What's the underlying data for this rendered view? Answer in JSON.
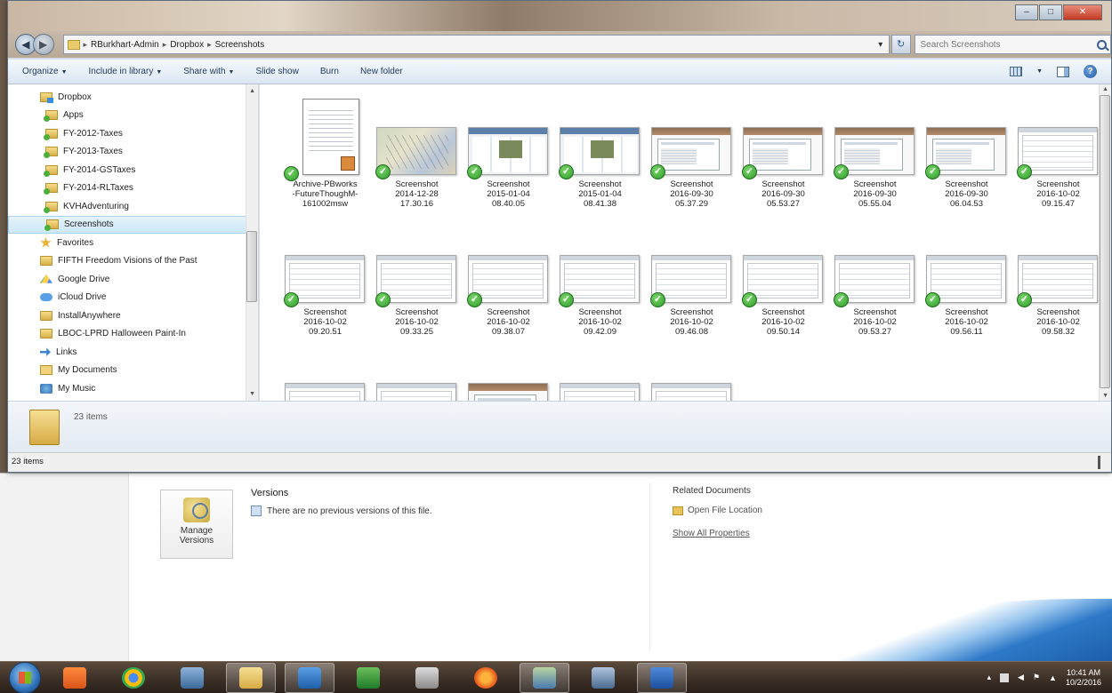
{
  "window": {
    "controls": {
      "minimize": "–",
      "maximize": "□",
      "close": "✕"
    }
  },
  "address": {
    "breadcrumbs": [
      "RBurkhart-Admin",
      "Dropbox",
      "Screenshots"
    ],
    "search_placeholder": "Search Screenshots"
  },
  "toolbar": {
    "items": [
      "Organize",
      "Include in library",
      "Share with",
      "Slide show",
      "Burn",
      "New folder"
    ]
  },
  "navpane": {
    "items": [
      {
        "label": "Dropbox",
        "icon": "dropbox-folder-icon"
      },
      {
        "label": "Apps",
        "icon": "folder-icon"
      },
      {
        "label": "FY-2012-Taxes",
        "icon": "folder-icon"
      },
      {
        "label": "FY-2013-Taxes",
        "icon": "folder-icon"
      },
      {
        "label": "FY-2014-GSTaxes",
        "icon": "folder-icon"
      },
      {
        "label": "FY-2014-RLTaxes",
        "icon": "folder-icon"
      },
      {
        "label": "KVHAdventuring",
        "icon": "folder-icon"
      },
      {
        "label": "Screenshots",
        "icon": "folder-icon"
      },
      {
        "label": "Favorites",
        "icon": "star-icon"
      },
      {
        "label": "FIFTH Freedom Visions of the Past",
        "icon": "folder-icon"
      },
      {
        "label": "Google Drive",
        "icon": "google-drive-icon"
      },
      {
        "label": "iCloud Drive",
        "icon": "icloud-icon"
      },
      {
        "label": "InstallAnywhere",
        "icon": "folder-icon"
      },
      {
        "label": "LBOC-LPRD Halloween Paint-In",
        "icon": "folder-icon"
      },
      {
        "label": "Links",
        "icon": "links-icon"
      },
      {
        "label": "My Documents",
        "icon": "documents-icon"
      },
      {
        "label": "My Music",
        "icon": "music-icon"
      }
    ]
  },
  "files": [
    {
      "name": "Archive-PBworks\n-FutureThoughM-\n161002msw",
      "kind": "doc"
    },
    {
      "name": "Screenshot\n2014-12-28\n17.30.16",
      "kind": "map"
    },
    {
      "name": "Screenshot\n2015-01-04\n08.40.05",
      "kind": "browser"
    },
    {
      "name": "Screenshot\n2015-01-04\n08.41.38",
      "kind": "browser"
    },
    {
      "name": "Screenshot\n2016-09-30\n05.37.29",
      "kind": "win"
    },
    {
      "name": "Screenshot\n2016-09-30\n05.53.27",
      "kind": "win"
    },
    {
      "name": "Screenshot\n2016-09-30\n05.55.04",
      "kind": "win"
    },
    {
      "name": "Screenshot\n2016-09-30\n06.04.53",
      "kind": "win"
    },
    {
      "name": "Screenshot\n2016-10-02\n09.15.47",
      "kind": "wht"
    },
    {
      "name": "Screenshot\n2016-10-02\n09.20.51",
      "kind": "wht"
    },
    {
      "name": "Screenshot\n2016-10-02\n09.33.25",
      "kind": "wht"
    },
    {
      "name": "Screenshot\n2016-10-02\n09.38.07",
      "kind": "wht"
    },
    {
      "name": "Screenshot\n2016-10-02\n09.42.09",
      "kind": "wht"
    },
    {
      "name": "Screenshot\n2016-10-02\n09.46.08",
      "kind": "wht"
    },
    {
      "name": "Screenshot\n2016-10-02\n09.50.14",
      "kind": "wht"
    },
    {
      "name": "Screenshot\n2016-10-02\n09.53.27",
      "kind": "wht"
    },
    {
      "name": "Screenshot\n2016-10-02\n09.56.11",
      "kind": "wht"
    },
    {
      "name": "Screenshot\n2016-10-02\n09.58.32",
      "kind": "wht"
    },
    {
      "name": "",
      "kind": "wht"
    },
    {
      "name": "",
      "kind": "wht"
    },
    {
      "name": "",
      "kind": "win"
    },
    {
      "name": "",
      "kind": "wht"
    },
    {
      "name": "",
      "kind": "wht"
    }
  ],
  "details": {
    "count": "23 items"
  },
  "status": {
    "count": "23 items"
  },
  "background_doc": {
    "manage_versions": "Manage\nVersions",
    "versions_title": "Versions",
    "versions_message": "There are no previous versions of this file.",
    "related_title": "Related Documents",
    "open_file_location": "Open File Location",
    "show_all_properties": "Show All Properties"
  },
  "taskbar": {
    "apps": [
      "media-player-icon",
      "chrome-icon",
      "network-icon",
      "explorer-icon",
      "outlook-icon",
      "excel-icon",
      "media-icon",
      "firefox-icon",
      "photos-icon",
      "app-icon",
      "word-icon"
    ],
    "clock_time": "10:41 AM",
    "clock_date": "10/2/2016"
  }
}
